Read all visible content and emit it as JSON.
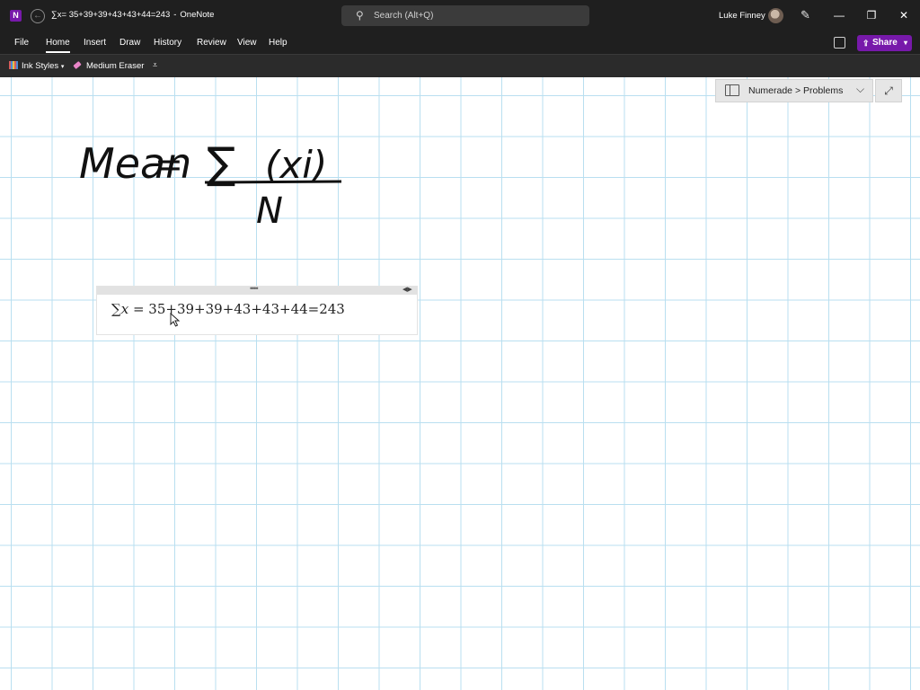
{
  "titlebar": {
    "app_icon": "N",
    "page_title": "∑x= 35+39+39+43+43+44=243",
    "separator": "-",
    "app_name": "OneNote",
    "search_placeholder": "Search (Alt+Q)",
    "user_name": "Luke Finney"
  },
  "menu": {
    "items": [
      "File",
      "Home",
      "Insert",
      "Draw",
      "History",
      "Review",
      "View",
      "Help"
    ],
    "share_label": "Share"
  },
  "toolbar": {
    "ink_styles": "Ink Styles",
    "eraser": "Medium Eraser"
  },
  "breadcrumb": {
    "path": "Numerade > Problems"
  },
  "ink": {
    "mean_word": "Mean",
    "equals": "=",
    "sigma": "∑",
    "numerator_var": "(xi)",
    "denominator": "N"
  },
  "math": {
    "sigma": "∑",
    "var": "x",
    "expression": " = 35+39+39+43+43+44=243"
  },
  "colors": {
    "accent_purple": "#7719aa",
    "grid_line": "#b9dff0",
    "titlebar_bg": "#1f1f1f"
  }
}
